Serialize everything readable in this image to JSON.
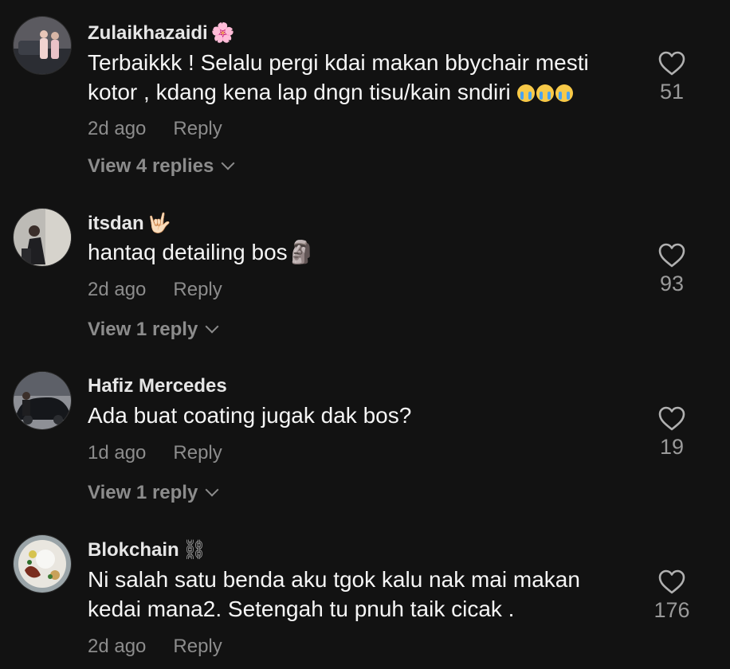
{
  "comments": [
    {
      "username": "Zulaikhazaidi",
      "badge": "🌸",
      "text_line1": "Terbaikkk ! Selalu pergi kdai makan bbychair mesti",
      "text_line2": "kotor , kdang kena lap dngn tisu/kain sndiri",
      "time": "2d ago",
      "reply_label": "Reply",
      "view_replies": "View 4 replies",
      "likes": "51"
    },
    {
      "username": "itsdan",
      "badge": "🤟🏻",
      "text": "hantaq detailing bos🗿",
      "time": "2d ago",
      "reply_label": "Reply",
      "view_replies": "View 1 reply",
      "likes": "93"
    },
    {
      "username": "Hafiz Mercedes",
      "badge": "",
      "text": "Ada buat coating jugak dak bos?",
      "time": "1d ago",
      "reply_label": "Reply",
      "view_replies": "View 1 reply",
      "likes": "19"
    },
    {
      "username": "Blokchain",
      "badge": "⛓",
      "text_line1": "Ni salah satu benda aku tgok kalu nak mai makan",
      "text_line2": "kedai mana2. Setengah tu pnuh taik cicak .",
      "time": "2d ago",
      "reply_label": "Reply",
      "likes": "176"
    }
  ],
  "colors": {
    "background": "#121212",
    "text": "#f5f5f5",
    "muted": "#8c8c8c"
  },
  "icons": {
    "like": "heart-outline-icon",
    "expand": "chevron-down-icon"
  }
}
